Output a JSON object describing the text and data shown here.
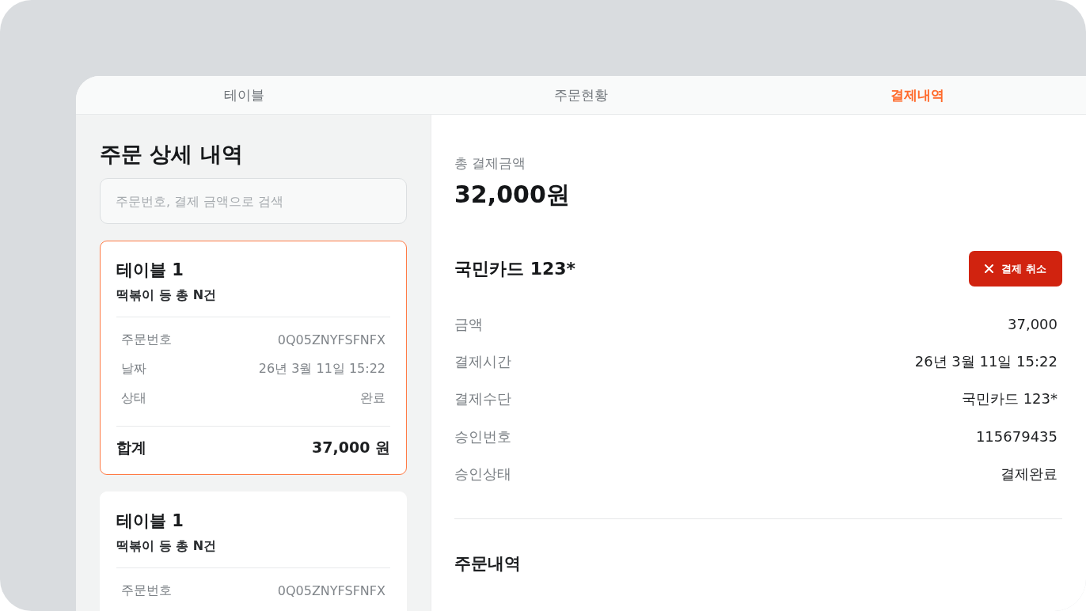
{
  "tabs": [
    {
      "label": "테이블",
      "selected": false
    },
    {
      "label": "주문현황",
      "selected": false
    },
    {
      "label": "결제내역",
      "selected": true
    }
  ],
  "order_list": {
    "title": "주문 상세 내역",
    "search": {
      "placeholder": "주문번호, 결제 금액으로 검색"
    },
    "orders": [
      {
        "table": "테이블 1",
        "summary": "떡볶이 등 총 N건",
        "selected": true,
        "details": [
          {
            "label": "주문번호",
            "value": "0Q05ZNYFSFNFX"
          },
          {
            "label": "날짜",
            "value": "26년 3월 11일 15:22"
          },
          {
            "label": "상태",
            "value": "완료"
          }
        ],
        "total_label": "합계",
        "total_value": "37,000 원"
      },
      {
        "table": "테이블 1",
        "summary": "떡볶이 등 총 N건",
        "selected": false,
        "details": [
          {
            "label": "주문번호",
            "value": "0Q05ZNYFSFNFX"
          }
        ]
      }
    ]
  },
  "payment": {
    "total_label": "총 결제금액",
    "total_amount": "32,000원",
    "card": "국민카드 123*",
    "cancel_button": "결제 취소",
    "details": [
      {
        "label": "금액",
        "value": "37,000"
      },
      {
        "label": "결제시간",
        "value": "26년 3월 11일 15:22"
      },
      {
        "label": "결제수단",
        "value": "국민카드 123*"
      },
      {
        "label": "승인번호",
        "value": "115679435"
      },
      {
        "label": "승인상태",
        "value": "결제완료"
      }
    ],
    "order_section_title": "주문내역"
  }
}
